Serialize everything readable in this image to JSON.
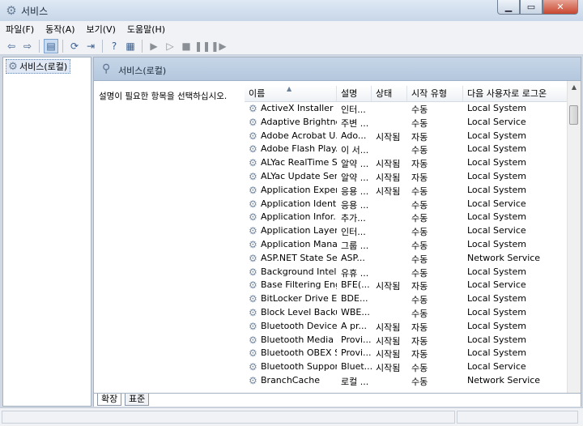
{
  "window": {
    "title": "서비스",
    "app_icon": "gear-icon"
  },
  "menu": [
    "파일(F)",
    "동작(A)",
    "보기(V)",
    "도움말(H)"
  ],
  "sidebar": {
    "items": [
      {
        "label": "서비스(로컬)"
      }
    ]
  },
  "main": {
    "header": "서비스(로컬)",
    "description": "설명이 필요한 항목을 선택하십시오.",
    "columns": [
      "이름",
      "설명",
      "상태",
      "시작 유형",
      "다음 사용자로 로그온"
    ],
    "rows": [
      {
        "name": "ActiveX Installer (...",
        "desc": "인터...",
        "status": "",
        "startup": "수동",
        "logon": "Local System"
      },
      {
        "name": "Adaptive Brightness",
        "desc": "주변 ...",
        "status": "",
        "startup": "수동",
        "logon": "Local Service"
      },
      {
        "name": "Adobe Acrobat U...",
        "desc": "Ado...",
        "status": "시작됨",
        "startup": "자동",
        "logon": "Local System"
      },
      {
        "name": "Adobe Flash Play...",
        "desc": "이 서...",
        "status": "",
        "startup": "수동",
        "logon": "Local System"
      },
      {
        "name": "ALYac RealTime S...",
        "desc": "알약 ...",
        "status": "시작됨",
        "startup": "자동",
        "logon": "Local System"
      },
      {
        "name": "ALYac Update Ser...",
        "desc": "알약 ...",
        "status": "시작됨",
        "startup": "자동",
        "logon": "Local System"
      },
      {
        "name": "Application Experi...",
        "desc": "응용 ...",
        "status": "시작됨",
        "startup": "수동",
        "logon": "Local System"
      },
      {
        "name": "Application Identity",
        "desc": "응용 ...",
        "status": "",
        "startup": "수동",
        "logon": "Local Service"
      },
      {
        "name": "Application Infor...",
        "desc": "추가...",
        "status": "",
        "startup": "수동",
        "logon": "Local System"
      },
      {
        "name": "Application Layer ...",
        "desc": "인터...",
        "status": "",
        "startup": "수동",
        "logon": "Local Service"
      },
      {
        "name": "Application Mana...",
        "desc": "그룹 ...",
        "status": "",
        "startup": "수동",
        "logon": "Local System"
      },
      {
        "name": "ASP.NET State Se...",
        "desc": "ASP...",
        "status": "",
        "startup": "수동",
        "logon": "Network Service"
      },
      {
        "name": "Background Intelli...",
        "desc": "유휴 ...",
        "status": "",
        "startup": "수동",
        "logon": "Local System"
      },
      {
        "name": "Base Filtering Eng...",
        "desc": "BFE(...",
        "status": "시작됨",
        "startup": "자동",
        "logon": "Local Service"
      },
      {
        "name": "BitLocker Drive E...",
        "desc": "BDE...",
        "status": "",
        "startup": "수동",
        "logon": "Local System"
      },
      {
        "name": "Block Level Backu...",
        "desc": "WBE...",
        "status": "",
        "startup": "수동",
        "logon": "Local System"
      },
      {
        "name": "Bluetooth Device ...",
        "desc": "A pr...",
        "status": "시작됨",
        "startup": "자동",
        "logon": "Local System"
      },
      {
        "name": "Bluetooth Media ...",
        "desc": "Provi...",
        "status": "시작됨",
        "startup": "자동",
        "logon": "Local System"
      },
      {
        "name": "Bluetooth OBEX S...",
        "desc": "Provi...",
        "status": "시작됨",
        "startup": "자동",
        "logon": "Local System"
      },
      {
        "name": "Bluetooth Suppor...",
        "desc": "Bluet...",
        "status": "시작됨",
        "startup": "수동",
        "logon": "Local Service"
      },
      {
        "name": "BranchCache",
        "desc": "로컬 ...",
        "status": "",
        "startup": "수동",
        "logon": "Network Service"
      }
    ],
    "tabs": [
      "확장",
      "표준"
    ]
  }
}
